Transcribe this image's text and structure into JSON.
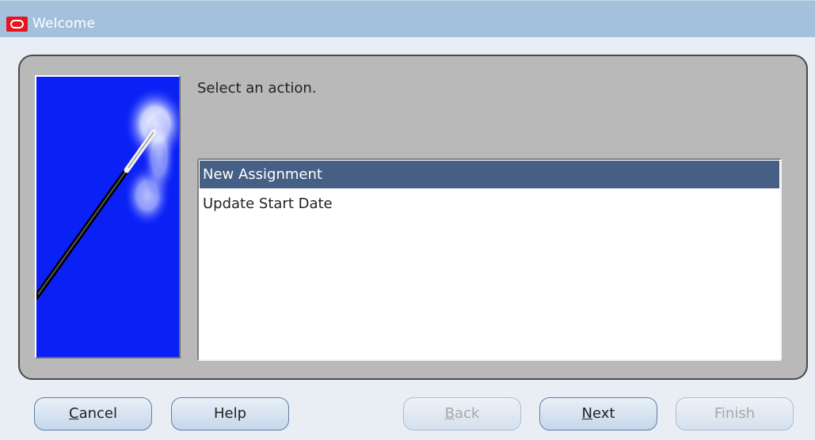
{
  "window": {
    "title": "Welcome",
    "logo_icon": "oracle-logo-icon"
  },
  "wizard_image": {
    "icon": "magic-wand-icon",
    "background_color": "#0a20f5"
  },
  "main": {
    "prompt": "Select an action.",
    "actions": [
      {
        "label": "New Assignment",
        "selected": true
      },
      {
        "label": "Update Start Date",
        "selected": false
      }
    ],
    "selection_color": "#465f84"
  },
  "buttons": {
    "cancel": {
      "label": "Cancel",
      "mnemonic": "C",
      "rest": "ancel",
      "enabled": true
    },
    "help": {
      "label": "Help",
      "mnemonic": "",
      "rest": "Help",
      "enabled": true
    },
    "back": {
      "label": "Back",
      "mnemonic": "B",
      "rest": "ack",
      "enabled": false
    },
    "next": {
      "label": "Next",
      "mnemonic": "N",
      "rest": "ext",
      "enabled": true
    },
    "finish": {
      "label": "Finish",
      "mnemonic": "",
      "rest": "Finish",
      "enabled": false
    }
  }
}
